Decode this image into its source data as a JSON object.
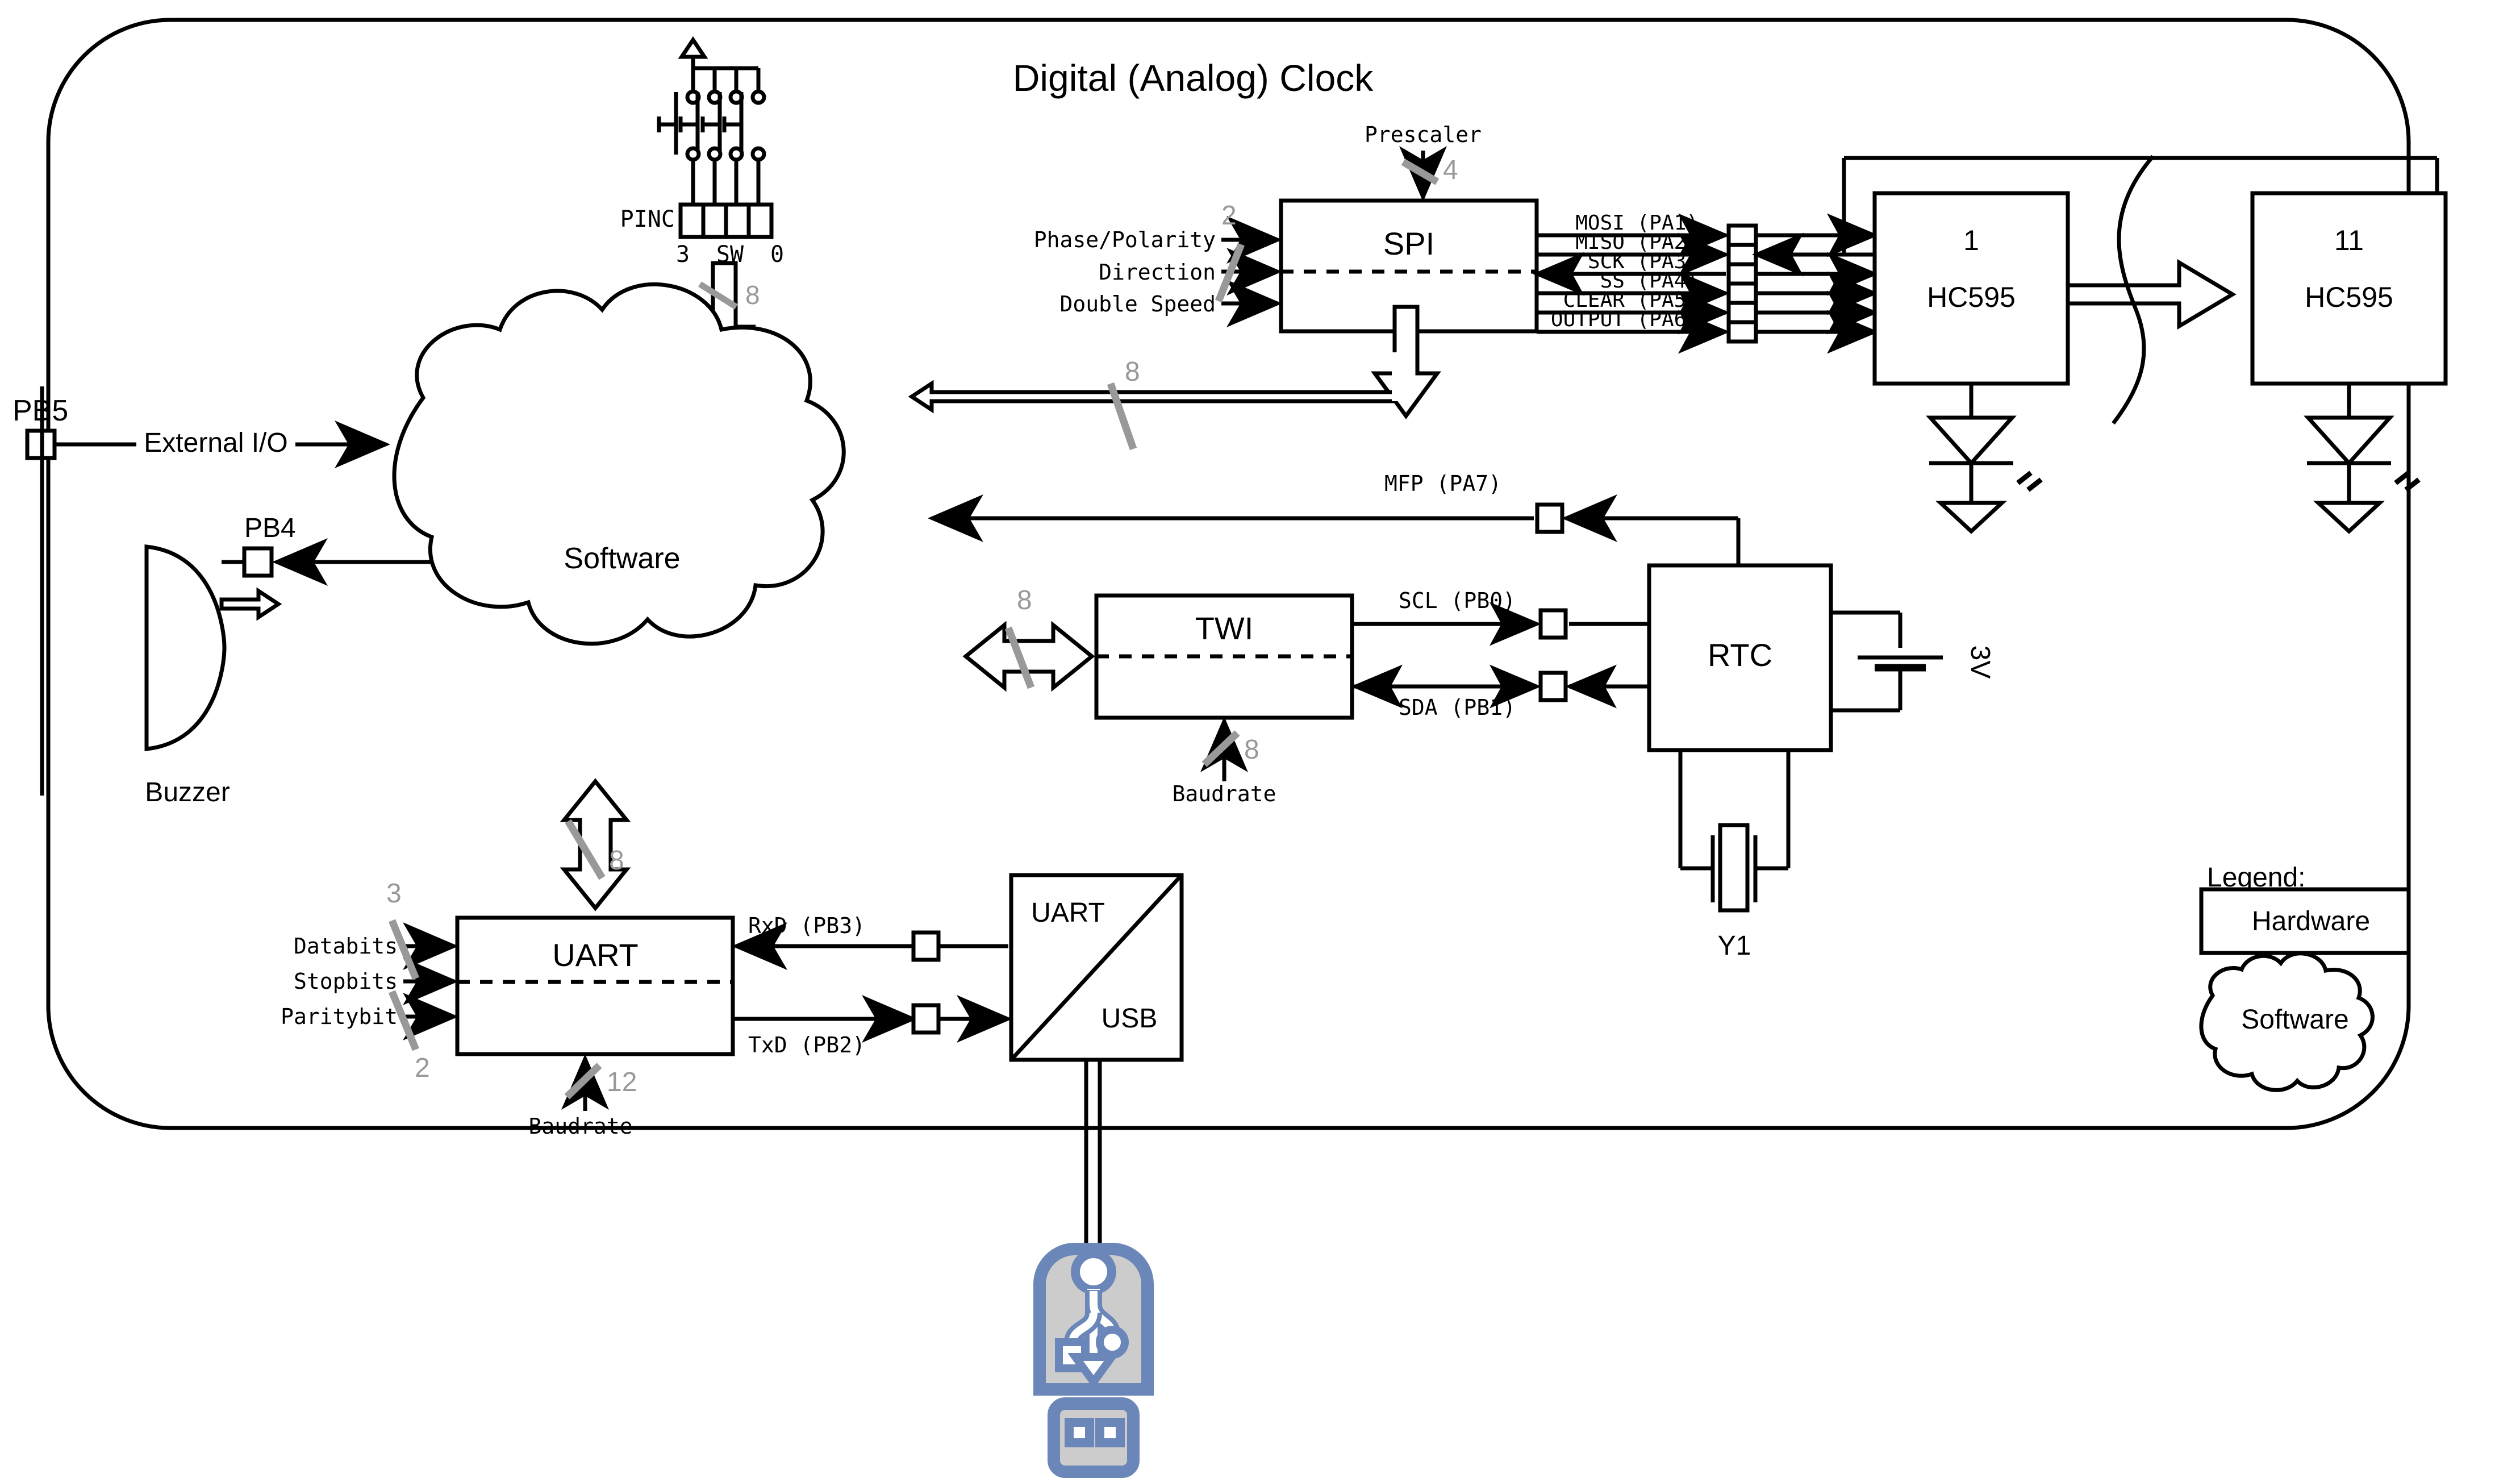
{
  "diagram": {
    "title": "Digital (Analog) Clock",
    "legend": {
      "heading": "Legend:",
      "hardware_label": "Hardware",
      "software_label": "Software"
    },
    "software_cloud_label": "Software",
    "blocks": {
      "spi": "SPI",
      "twi": "TWI",
      "uart": "UART",
      "uart_usb_top": "UART",
      "uart_usb_bottom": "USB",
      "rtc": "RTC",
      "hc595_left_number": "1",
      "hc595_left_name": "HC595",
      "hc595_right_number": "11",
      "hc595_right_name": "HC595"
    },
    "spi_inputs": {
      "phase_polarity": "Phase/Polarity",
      "direction": "Direction",
      "double_speed": "Double Speed",
      "prescaler": "Prescaler",
      "phase_polarity_bits": "2",
      "prescaler_bits": "4",
      "bus_bits": "8"
    },
    "spi_outputs": [
      "MOSI (PA1)",
      "MISO (PA2)",
      "SCK (PA3)",
      "SS (PA4)",
      "CLEAR (PA5)",
      "OUTPUT (PA6)"
    ],
    "twi_signals": {
      "mfp": "MFP (PA7)",
      "scl": "SCL (PB0)",
      "sda": "SDA (PB1)",
      "baudrate": "Baudrate",
      "baudrate_bits": "8",
      "bus_bits": "8"
    },
    "uart_inputs": {
      "databits": "Databits",
      "stopbits": "Stopbits",
      "paritybit": "Paritybit",
      "baudrate": "Baudrate",
      "databits_bits": "3",
      "paritybit_bits": "2",
      "baudrate_bits": "12",
      "bus_bits": "8"
    },
    "uart_outputs": {
      "rxd": "RxD (PB3)",
      "txd": "TxD (PB2)"
    },
    "pins": {
      "pb5": "PB5",
      "pb4": "PB4",
      "external_io": "External I/O",
      "buzzer": "Buzzer",
      "pinc": "PINC",
      "switch_bit_high": "3",
      "switch_name": "SW",
      "switch_bit_low": "0",
      "switch_bus_bits": "8"
    },
    "rtc_parts": {
      "battery": "3V",
      "crystal": "Y1"
    },
    "colors": {
      "line": "#000000",
      "bit_marker": "#999999",
      "usb_icon_stroke": "#6b86b8",
      "usb_icon_fill": "#cccccc"
    }
  }
}
